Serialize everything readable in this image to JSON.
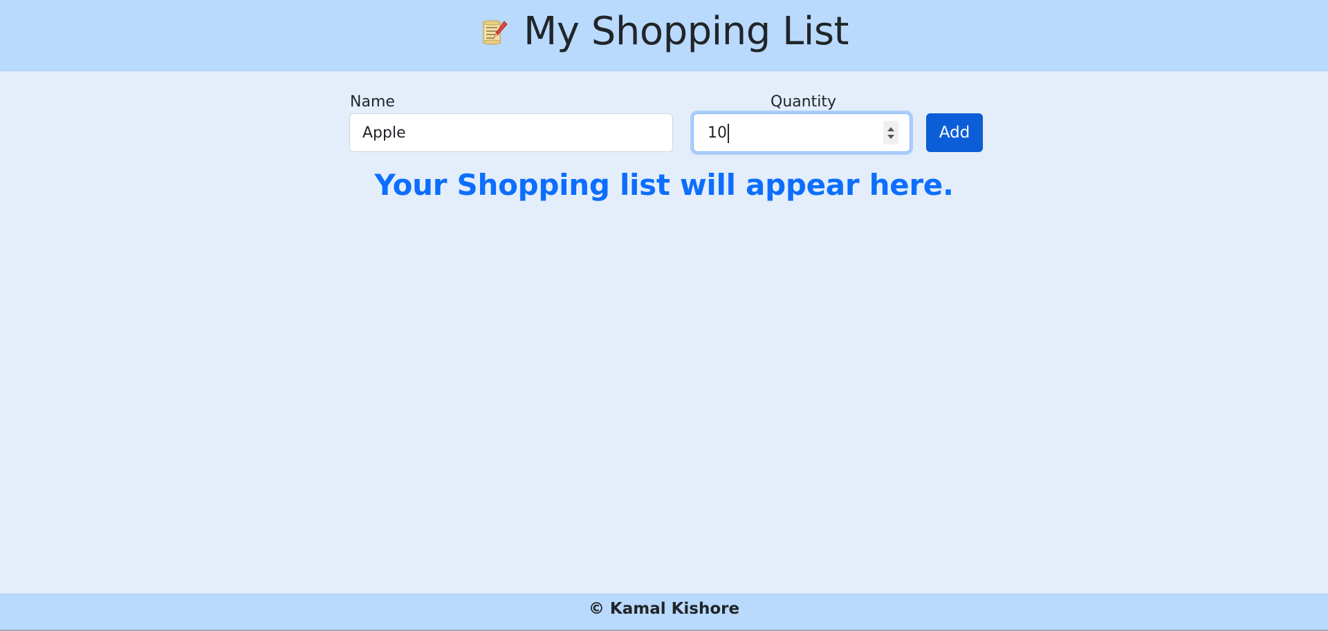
{
  "header": {
    "title": "My Shopping List",
    "logo_icon": "scroll-pencil-icon"
  },
  "form": {
    "name_label": "Name",
    "name_value": "Apple",
    "quantity_label": "Quantity",
    "quantity_value": "10",
    "add_label": "Add"
  },
  "list": {
    "empty_message": "Your Shopping list will appear here."
  },
  "footer": {
    "text": "© Kamal Kishore"
  },
  "colors": {
    "header_bg": "#b9dafd",
    "page_bg": "#e3eefa",
    "accent": "#0b5ed7",
    "message": "#0d6efd"
  }
}
